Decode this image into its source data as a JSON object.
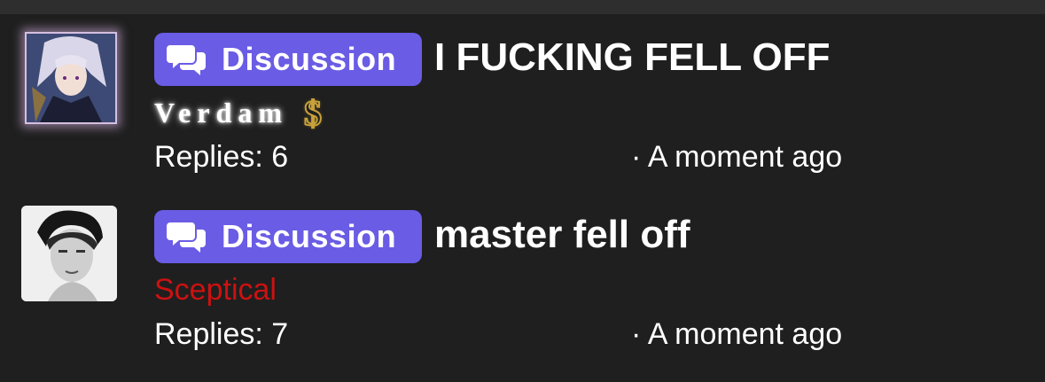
{
  "threads": [
    {
      "badge": "Discussion",
      "title": "I FUCKING FELL OFF",
      "author": "Verdam",
      "author_icon": "dollar-sign-icon",
      "replies_label": "Replies: 6",
      "time": "· A moment ago"
    },
    {
      "badge": "Discussion",
      "title": "master fell off",
      "author": "Sceptical",
      "replies_label": "Replies: 7",
      "time": "· A moment ago"
    }
  ],
  "colors": {
    "background": "#1f1f1f",
    "badge": "#6a5ce5",
    "author_red": "#cc1111",
    "dollar_gold": "#c9a13a",
    "avatar_glow": "#d6bfe0"
  }
}
